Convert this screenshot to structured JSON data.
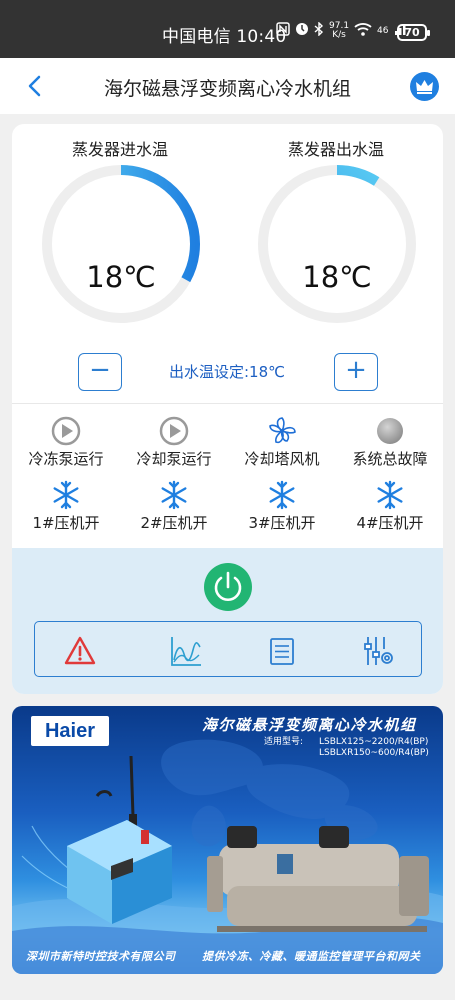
{
  "status_bar": {
    "carrier_time": "中国电信 10:40",
    "network_speed_value": "97.1",
    "network_speed_unit": "K/s",
    "signal": "46",
    "battery": "70"
  },
  "header": {
    "title": "海尔磁悬浮变频离心冷水机组",
    "back_icon": "chevron-left-icon",
    "crown_icon": "crown-icon"
  },
  "gauges": [
    {
      "label": "蒸发器进水温",
      "value": "18℃",
      "fill_fraction": 0.33
    },
    {
      "label": "蒸发器出水温",
      "value": "18℃",
      "fill_fraction": 0.09
    }
  ],
  "setpoint": {
    "minus_label": "−",
    "plus_label": "+",
    "text": "出水温设定:18℃"
  },
  "status_items": [
    {
      "label": "冷冻泵运行",
      "icon": "play-circle-icon",
      "state": "off"
    },
    {
      "label": "冷却泵运行",
      "icon": "play-circle-icon",
      "state": "off"
    },
    {
      "label": "冷却塔风机",
      "icon": "fan-icon",
      "state": "on"
    },
    {
      "label": "系统总故障",
      "icon": "status-dot-icon",
      "state": "off"
    },
    {
      "label": "1#压机开",
      "icon": "snowflake-icon",
      "state": "on"
    },
    {
      "label": "2#压机开",
      "icon": "snowflake-icon",
      "state": "on"
    },
    {
      "label": "3#压机开",
      "icon": "snowflake-icon",
      "state": "on"
    },
    {
      "label": "4#压机开",
      "icon": "snowflake-icon",
      "state": "on"
    }
  ],
  "controls": {
    "power_icon": "power-icon",
    "tools": [
      "warning-icon",
      "chart-icon",
      "list-icon",
      "settings-sliders-icon"
    ]
  },
  "banner": {
    "brand": "Haier",
    "title": "海尔磁悬浮变频离心冷水机组",
    "model_label": "适用型号:",
    "model_1": "LSBLX125~2200/R4(BP)",
    "model_2": "LSBLXR150~600/R4(BP)",
    "footer_left": "深圳市新特时控技术有限公司",
    "footer_right": "提供冷冻、冷藏、暖通监控管理平台和网关"
  },
  "colors": {
    "accent": "#2d7ed0",
    "gauge_start": "#5fd4f5",
    "gauge_end": "#1f7fe0",
    "power": "#22b573",
    "warning": "#e03a3a",
    "ctrl_bg": "#dcecf7"
  }
}
